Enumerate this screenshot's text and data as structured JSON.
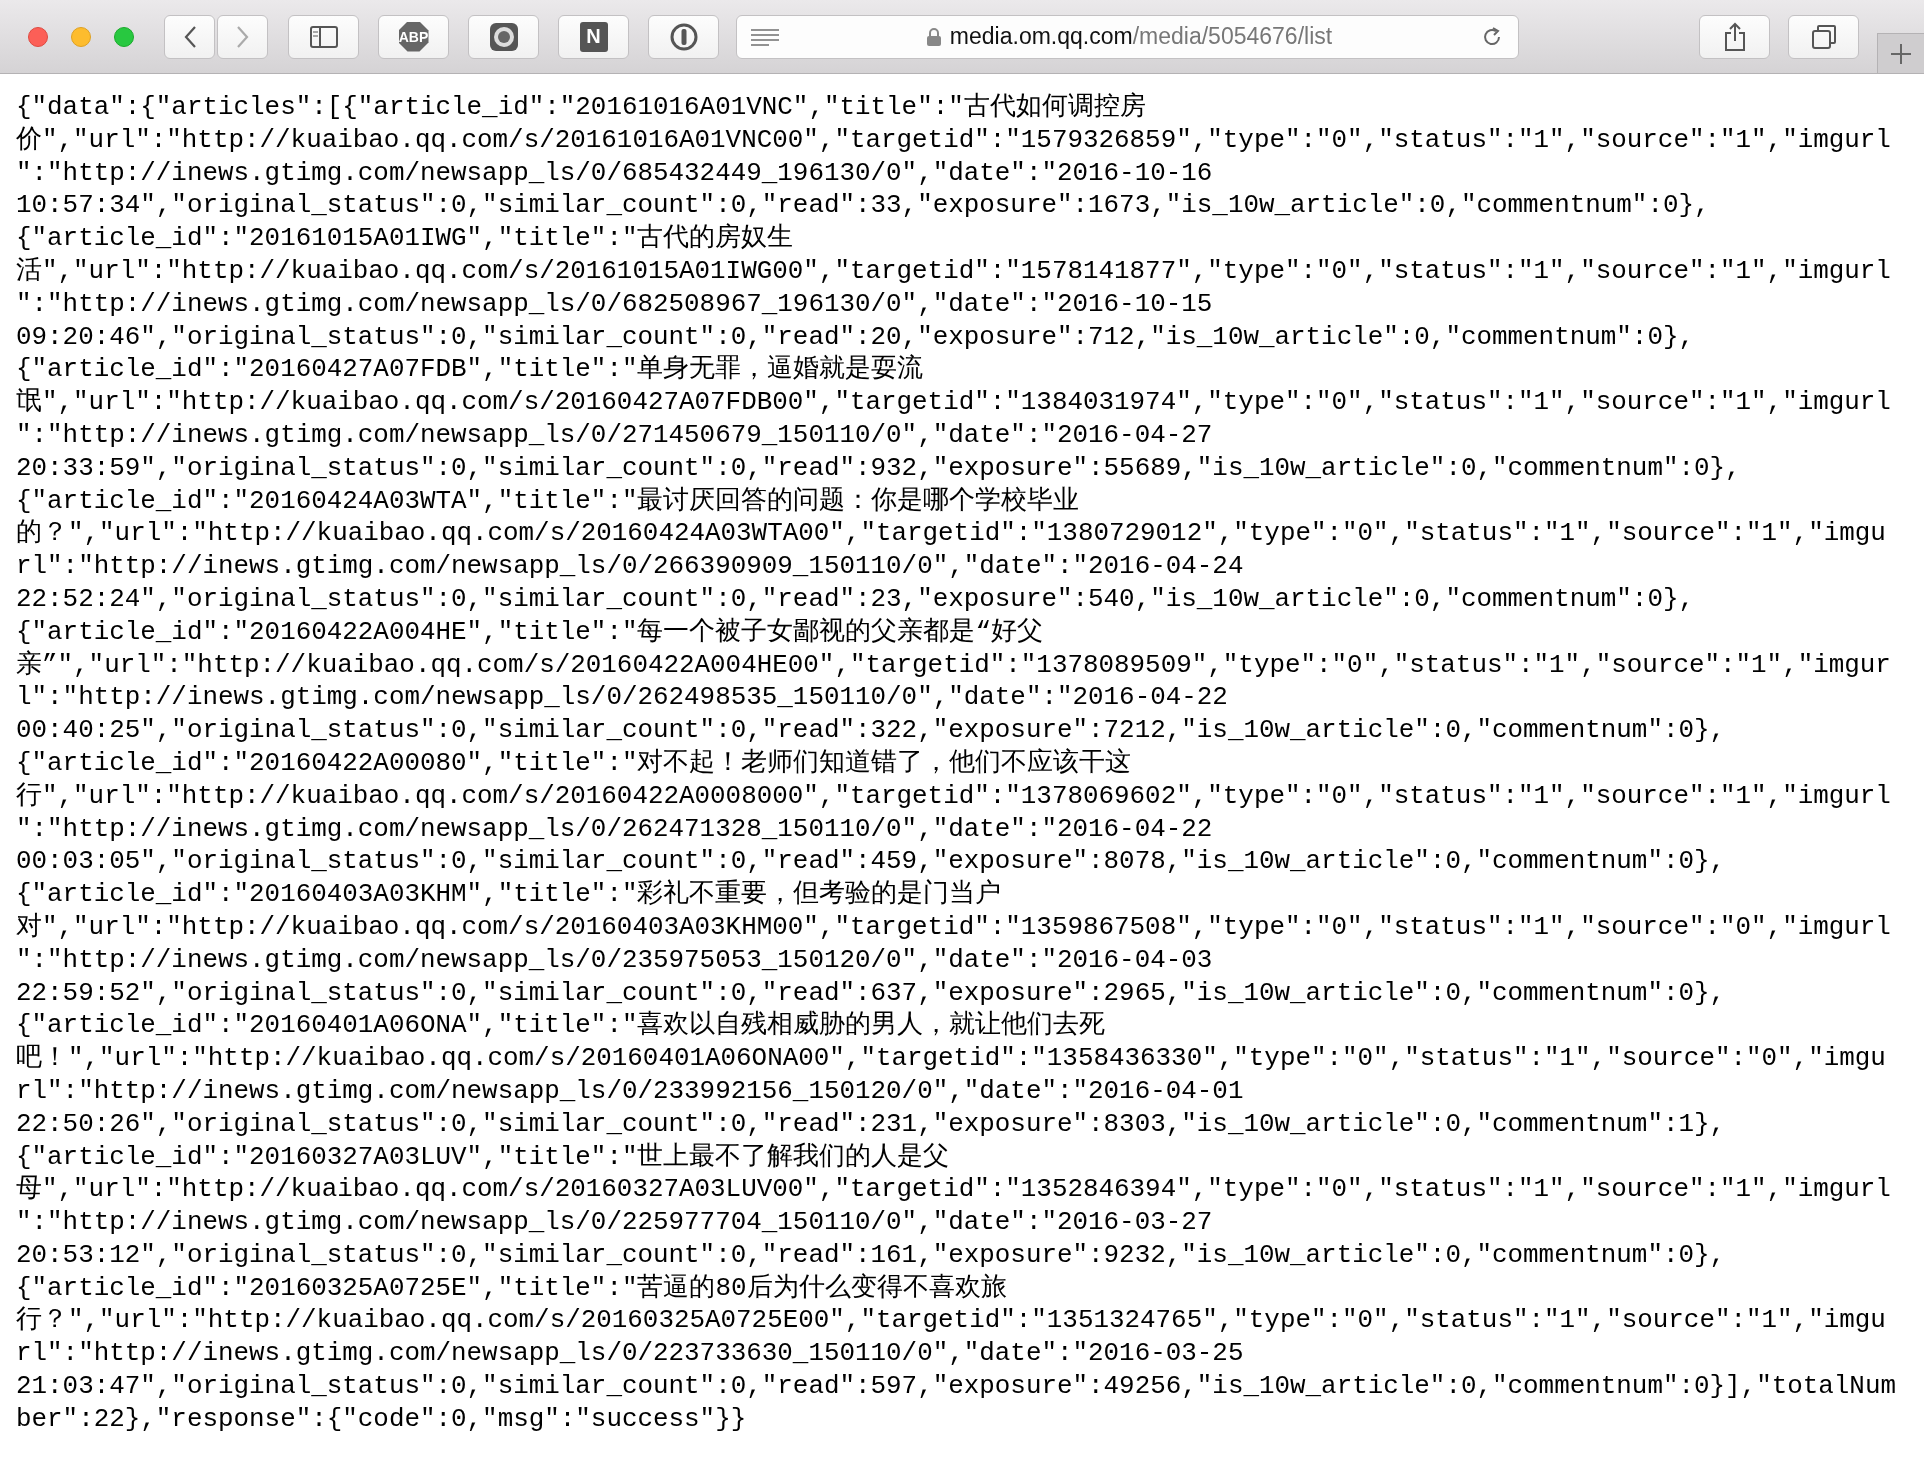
{
  "toolbar": {
    "abp_label": "ABP",
    "onenote_label": "N",
    "address": {
      "host": "media.om.qq.com",
      "path": "/media/5054676/list"
    }
  },
  "body": {
    "lines": [
      "{\"data\":{\"articles\":[{\"article_id\":\"20161016A01VNC\",\"title\":\"古代如何调控房",
      "价\",\"url\":\"http://kuaibao.qq.com/s/20161016A01VNC00\",\"targetid\":\"1579326859\",\"type\":\"0\",\"status\":\"1\",\"source\":\"1\",\"imgurl",
      "\":\"http://inews.gtimg.com/newsapp_ls/0/685432449_196130/0\",\"date\":\"2016-10-16",
      "10:57:34\",\"original_status\":0,\"similar_count\":0,\"read\":33,\"exposure\":1673,\"is_10w_article\":0,\"commentnum\":0},",
      "{\"article_id\":\"20161015A01IWG\",\"title\":\"古代的房奴生",
      "活\",\"url\":\"http://kuaibao.qq.com/s/20161015A01IWG00\",\"targetid\":\"1578141877\",\"type\":\"0\",\"status\":\"1\",\"source\":\"1\",\"imgurl",
      "\":\"http://inews.gtimg.com/newsapp_ls/0/682508967_196130/0\",\"date\":\"2016-10-15",
      "09:20:46\",\"original_status\":0,\"similar_count\":0,\"read\":20,\"exposure\":712,\"is_10w_article\":0,\"commentnum\":0},",
      "{\"article_id\":\"20160427A07FDB\",\"title\":\"单身无罪，逼婚就是耍流",
      "氓\",\"url\":\"http://kuaibao.qq.com/s/20160427A07FDB00\",\"targetid\":\"1384031974\",\"type\":\"0\",\"status\":\"1\",\"source\":\"1\",\"imgurl",
      "\":\"http://inews.gtimg.com/newsapp_ls/0/271450679_150110/0\",\"date\":\"2016-04-27",
      "20:33:59\",\"original_status\":0,\"similar_count\":0,\"read\":932,\"exposure\":55689,\"is_10w_article\":0,\"commentnum\":0},",
      "{\"article_id\":\"20160424A03WTA\",\"title\":\"最讨厌回答的问题：你是哪个学校毕业",
      "的？\",\"url\":\"http://kuaibao.qq.com/s/20160424A03WTA00\",\"targetid\":\"1380729012\",\"type\":\"0\",\"status\":\"1\",\"source\":\"1\",\"imgu",
      "rl\":\"http://inews.gtimg.com/newsapp_ls/0/266390909_150110/0\",\"date\":\"2016-04-24",
      "22:52:24\",\"original_status\":0,\"similar_count\":0,\"read\":23,\"exposure\":540,\"is_10w_article\":0,\"commentnum\":0},",
      "{\"article_id\":\"20160422A004HE\",\"title\":\"每一个被子女鄙视的父亲都是“好父",
      "亲”\",\"url\":\"http://kuaibao.qq.com/s/20160422A004HE00\",\"targetid\":\"1378089509\",\"type\":\"0\",\"status\":\"1\",\"source\":\"1\",\"imgur",
      "l\":\"http://inews.gtimg.com/newsapp_ls/0/262498535_150110/0\",\"date\":\"2016-04-22",
      "00:40:25\",\"original_status\":0,\"similar_count\":0,\"read\":322,\"exposure\":7212,\"is_10w_article\":0,\"commentnum\":0},",
      "{\"article_id\":\"20160422A00080\",\"title\":\"对不起！老师们知道错了，他们不应该干这",
      "行\",\"url\":\"http://kuaibao.qq.com/s/20160422A0008000\",\"targetid\":\"1378069602\",\"type\":\"0\",\"status\":\"1\",\"source\":\"1\",\"imgurl",
      "\":\"http://inews.gtimg.com/newsapp_ls/0/262471328_150110/0\",\"date\":\"2016-04-22",
      "00:03:05\",\"original_status\":0,\"similar_count\":0,\"read\":459,\"exposure\":8078,\"is_10w_article\":0,\"commentnum\":0},",
      "{\"article_id\":\"20160403A03KHM\",\"title\":\"彩礼不重要，但考验的是门当户",
      "对\",\"url\":\"http://kuaibao.qq.com/s/20160403A03KHM00\",\"targetid\":\"1359867508\",\"type\":\"0\",\"status\":\"1\",\"source\":\"0\",\"imgurl",
      "\":\"http://inews.gtimg.com/newsapp_ls/0/235975053_150120/0\",\"date\":\"2016-04-03",
      "22:59:52\",\"original_status\":0,\"similar_count\":0,\"read\":637,\"exposure\":2965,\"is_10w_article\":0,\"commentnum\":0},",
      "{\"article_id\":\"20160401A06ONA\",\"title\":\"喜欢以自残相威胁的男人，就让他们去死",
      "吧！\",\"url\":\"http://kuaibao.qq.com/s/20160401A06ONA00\",\"targetid\":\"1358436330\",\"type\":\"0\",\"status\":\"1\",\"source\":\"0\",\"imgu",
      "rl\":\"http://inews.gtimg.com/newsapp_ls/0/233992156_150120/0\",\"date\":\"2016-04-01",
      "22:50:26\",\"original_status\":0,\"similar_count\":0,\"read\":231,\"exposure\":8303,\"is_10w_article\":0,\"commentnum\":1},",
      "{\"article_id\":\"20160327A03LUV\",\"title\":\"世上最不了解我们的人是父",
      "母\",\"url\":\"http://kuaibao.qq.com/s/20160327A03LUV00\",\"targetid\":\"1352846394\",\"type\":\"0\",\"status\":\"1\",\"source\":\"1\",\"imgurl",
      "\":\"http://inews.gtimg.com/newsapp_ls/0/225977704_150110/0\",\"date\":\"2016-03-27",
      "20:53:12\",\"original_status\":0,\"similar_count\":0,\"read\":161,\"exposure\":9232,\"is_10w_article\":0,\"commentnum\":0},",
      "{\"article_id\":\"20160325A0725E\",\"title\":\"苦逼的80后为什么变得不喜欢旅",
      "行？\",\"url\":\"http://kuaibao.qq.com/s/20160325A0725E00\",\"targetid\":\"1351324765\",\"type\":\"0\",\"status\":\"1\",\"source\":\"1\",\"imgu",
      "rl\":\"http://inews.gtimg.com/newsapp_ls/0/223733630_150110/0\",\"date\":\"2016-03-25",
      "21:03:47\",\"original_status\":0,\"similar_count\":0,\"read\":597,\"exposure\":49256,\"is_10w_article\":0,\"commentnum\":0}],\"totalNum",
      "ber\":22},\"response\":{\"code\":0,\"msg\":\"success\"}}"
    ]
  }
}
